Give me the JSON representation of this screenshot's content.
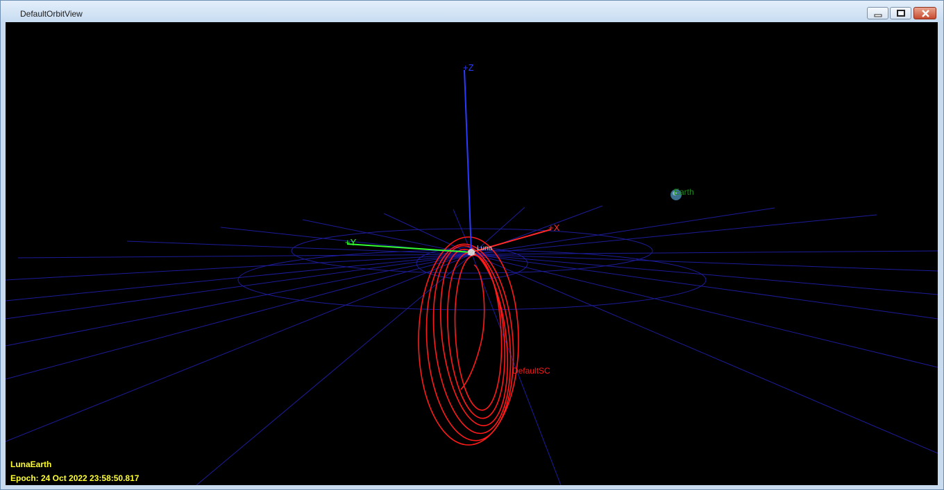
{
  "window": {
    "title": "DefaultOrbitView"
  },
  "axes": {
    "x_label": "+X",
    "y_label": "+Y",
    "z_label": "+Z",
    "x_color": "#ff2a2a",
    "y_color": "#33ff33",
    "z_color": "#2a3aff"
  },
  "bodies": {
    "earth_label": "Earth",
    "earth_label_color": "#1f8a1f",
    "luna_label": "Luna",
    "sc_marker": "SC"
  },
  "spacecraft": {
    "label": "DefaultSC",
    "color": "#ff1a1a"
  },
  "grid": {
    "color": "#1c1c9a"
  },
  "hud": {
    "coordinate_system": "LunaEarth",
    "epoch": "Epoch: 24 Oct 2022 23:58:50.817",
    "color": "#ffff33"
  },
  "icons": [
    "minimize-icon",
    "restore-icon",
    "close-icon"
  ]
}
